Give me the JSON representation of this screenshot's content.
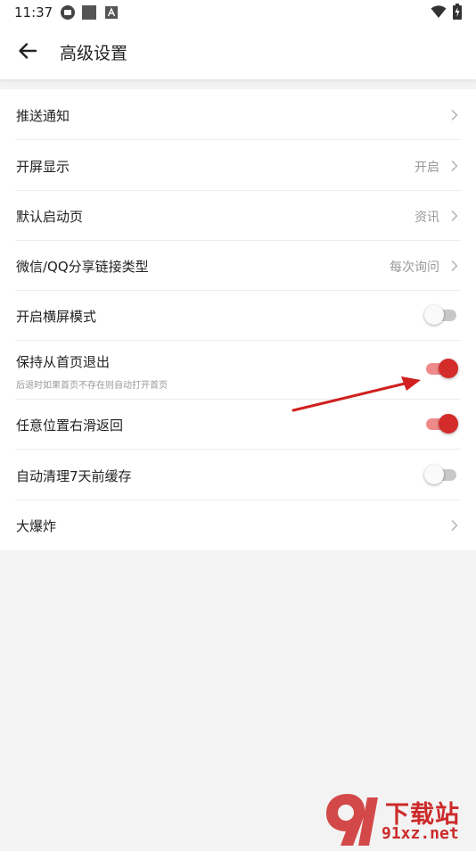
{
  "status_bar": {
    "time": "11:37",
    "icons_left": [
      "notification-app-icon",
      "notification-square-icon",
      "notification-a-icon"
    ],
    "icons_right": [
      "wifi-icon",
      "battery-charging-icon"
    ]
  },
  "header": {
    "back_icon": "arrow-left-icon",
    "title": "高级设置"
  },
  "settings": [
    {
      "id": "push",
      "label": "推送通知",
      "value": "",
      "control": "chevron"
    },
    {
      "id": "splash",
      "label": "开屏显示",
      "value": "开启",
      "control": "chevron"
    },
    {
      "id": "default-page",
      "label": "默认启动页",
      "value": "资讯",
      "control": "chevron"
    },
    {
      "id": "share-link",
      "label": "微信/QQ分享链接类型",
      "value": "每次询问",
      "control": "chevron"
    },
    {
      "id": "landscape",
      "label": "开启横屏模式",
      "control": "toggle",
      "checked": false
    },
    {
      "id": "keep-home",
      "label": "保持从首页退出",
      "sublabel": "后退时如果首页不存在则自动打开首页",
      "control": "toggle",
      "checked": true
    },
    {
      "id": "swipe-back",
      "label": "任意位置右滑返回",
      "control": "toggle",
      "checked": true
    },
    {
      "id": "auto-clean",
      "label": "自动清理7天前缓存",
      "control": "toggle",
      "checked": false
    },
    {
      "id": "big-bang",
      "label": "大爆炸",
      "value": "",
      "control": "chevron"
    }
  ],
  "annotation": {
    "type": "red-arrow",
    "points_to": "keep-home"
  },
  "watermark": {
    "brand": "下载站",
    "url": "91xz.net"
  },
  "colors": {
    "accent": "#d42b2b",
    "accent_track": "#ef8a8a",
    "background": "#f3f3f3",
    "row_value": "#999999"
  }
}
